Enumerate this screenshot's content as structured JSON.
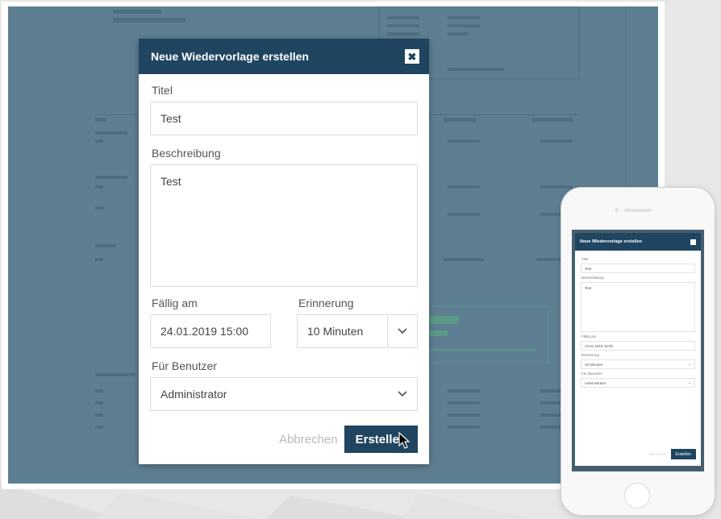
{
  "modal": {
    "title": "Neue Wiedervorlage erstellen",
    "close_glyph": "✖",
    "fields": {
      "title_label": "Titel",
      "title_value": "Test",
      "description_label": "Beschreibung",
      "description_value": "Test",
      "due_label": "Fällig am",
      "due_value": "24.01.2019 15:00",
      "reminder_label": "Erinnerung",
      "reminder_value": "10 Minuten",
      "user_label": "Für Benutzer",
      "user_value": "Administrator"
    },
    "cancel_label": "Abbrechen",
    "create_label": "Erstellen"
  },
  "colors": {
    "header": "#1f4560",
    "overlay": "#5e7f92",
    "button": "#1f4560"
  },
  "icons": [
    "close-icon",
    "chevron-down-icon",
    "mouse-cursor-icon"
  ]
}
